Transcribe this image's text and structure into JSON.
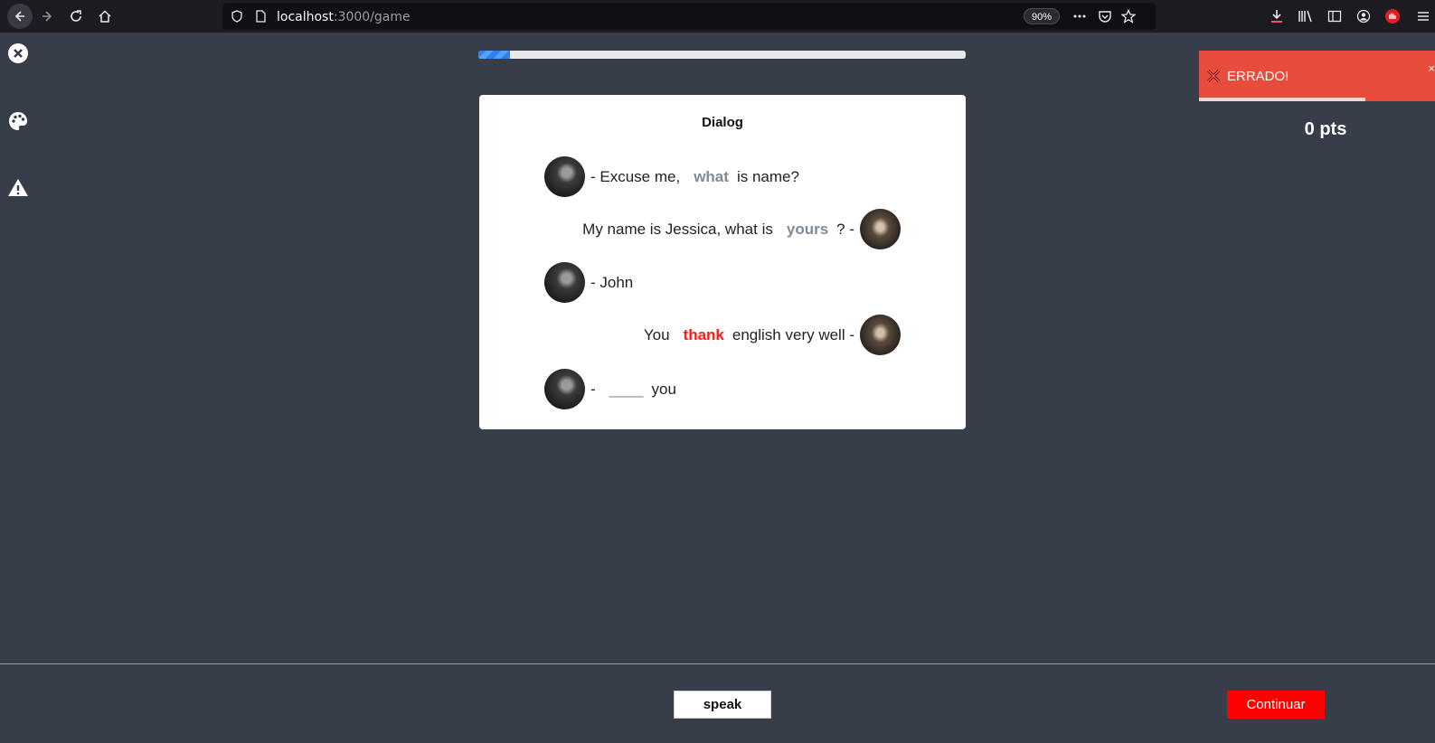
{
  "browser": {
    "url_host": "localhost",
    "url_path": ":3000/game",
    "zoom": "90%"
  },
  "progress": {
    "fraction": 0.065
  },
  "dialog": {
    "title": "Dialog",
    "lines": [
      {
        "speaker": "male",
        "before": "- Excuse me,",
        "word": "what",
        "after": "is name?"
      },
      {
        "speaker": "female",
        "before": "My name is Jessica, what is",
        "word": "yours",
        "after": "? -"
      },
      {
        "speaker": "male",
        "text": "- John"
      },
      {
        "speaker": "female",
        "before": "You",
        "word": "thank",
        "after": "english very well -"
      },
      {
        "speaker": "male",
        "before": "-",
        "blank": "____",
        "after": "you"
      }
    ]
  },
  "toast": {
    "message": "ERRADO!",
    "close": "×",
    "color": "#e74c3c"
  },
  "score": {
    "points": "0 pts"
  },
  "footer": {
    "speak_label": "speak",
    "continue_label": "Continuar"
  },
  "icons": {
    "side": [
      "close-circle-icon",
      "palette-icon",
      "warning-icon"
    ],
    "toolbar": [
      "back-icon",
      "forward-icon",
      "reload-icon",
      "home-icon",
      "shield-icon",
      "page-icon",
      "more-icon",
      "pocket-icon",
      "star-icon",
      "download-icon",
      "library-icon",
      "sidebar-icon",
      "account-icon",
      "extension-icon",
      "menu-icon"
    ]
  }
}
